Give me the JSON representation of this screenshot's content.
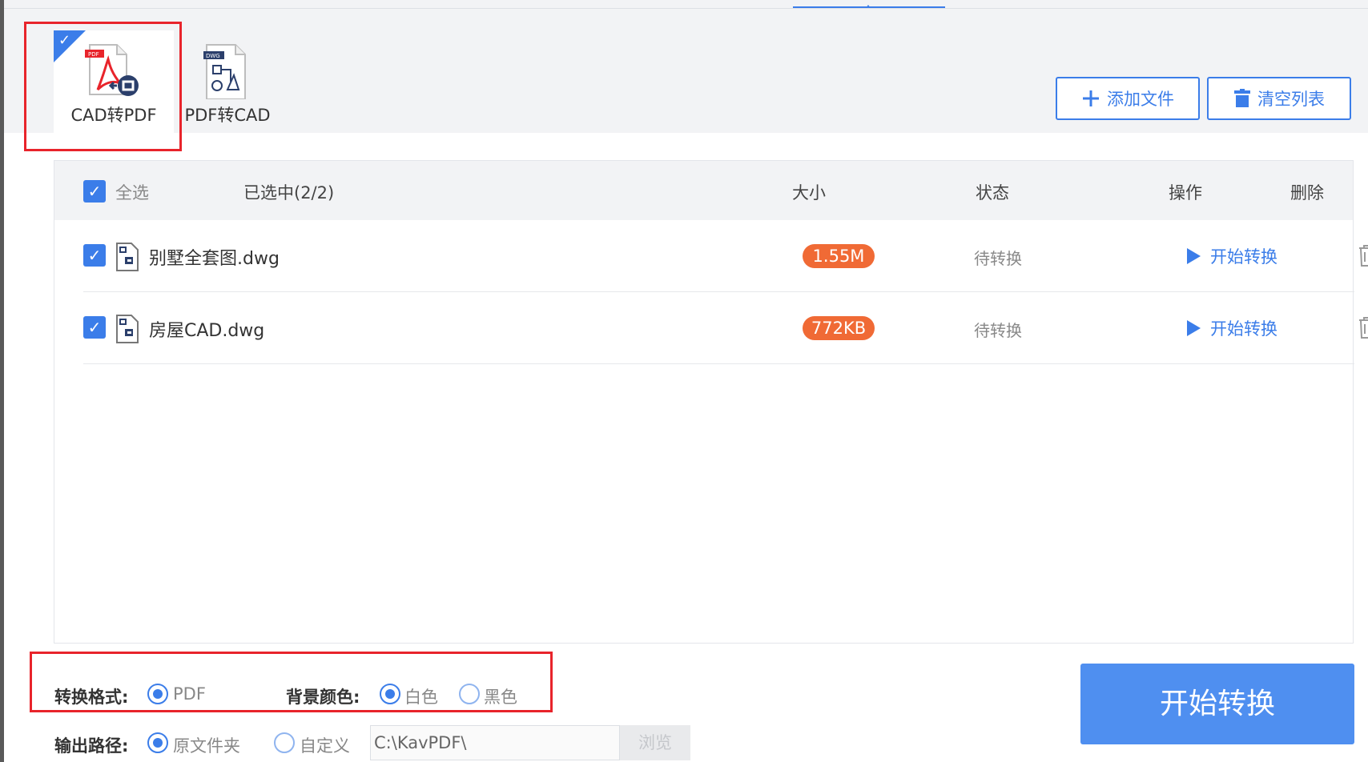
{
  "tabs": [
    {
      "label": "CAD转PDF",
      "active": true,
      "icon": "cad-to-pdf-icon"
    },
    {
      "label": "PDF转CAD",
      "active": false,
      "icon": "pdf-to-cad-icon"
    }
  ],
  "toolbar": {
    "add_label": "添加文件",
    "clear_label": "清空列表"
  },
  "table": {
    "select_all_label": "全选",
    "selected_count": "已选中(2/2)",
    "col_size": "大小",
    "col_status": "状态",
    "col_action": "操作",
    "col_delete": "删除",
    "rows": [
      {
        "name": "别墅全套图.dwg",
        "size": "1.55M",
        "status": "待转换",
        "action": "开始转换",
        "checked": true
      },
      {
        "name": "房屋CAD.dwg",
        "size": "772KB",
        "status": "待转换",
        "action": "开始转换",
        "checked": true
      }
    ]
  },
  "options": {
    "format_label": "转换格式:",
    "format_value": "PDF",
    "bg_label": "背景颜色:",
    "bg_white": "白色",
    "bg_black": "黑色",
    "output_label": "输出路径:",
    "output_source": "原文件夹",
    "output_custom": "自定义",
    "path_value": "C:\\KavPDF\\",
    "browse_label": "浏览"
  },
  "start_button_label": "开始转换",
  "colors": {
    "accent": "#3b7de9",
    "size_badge": "#f06a35",
    "highlight": "#e8242b"
  }
}
